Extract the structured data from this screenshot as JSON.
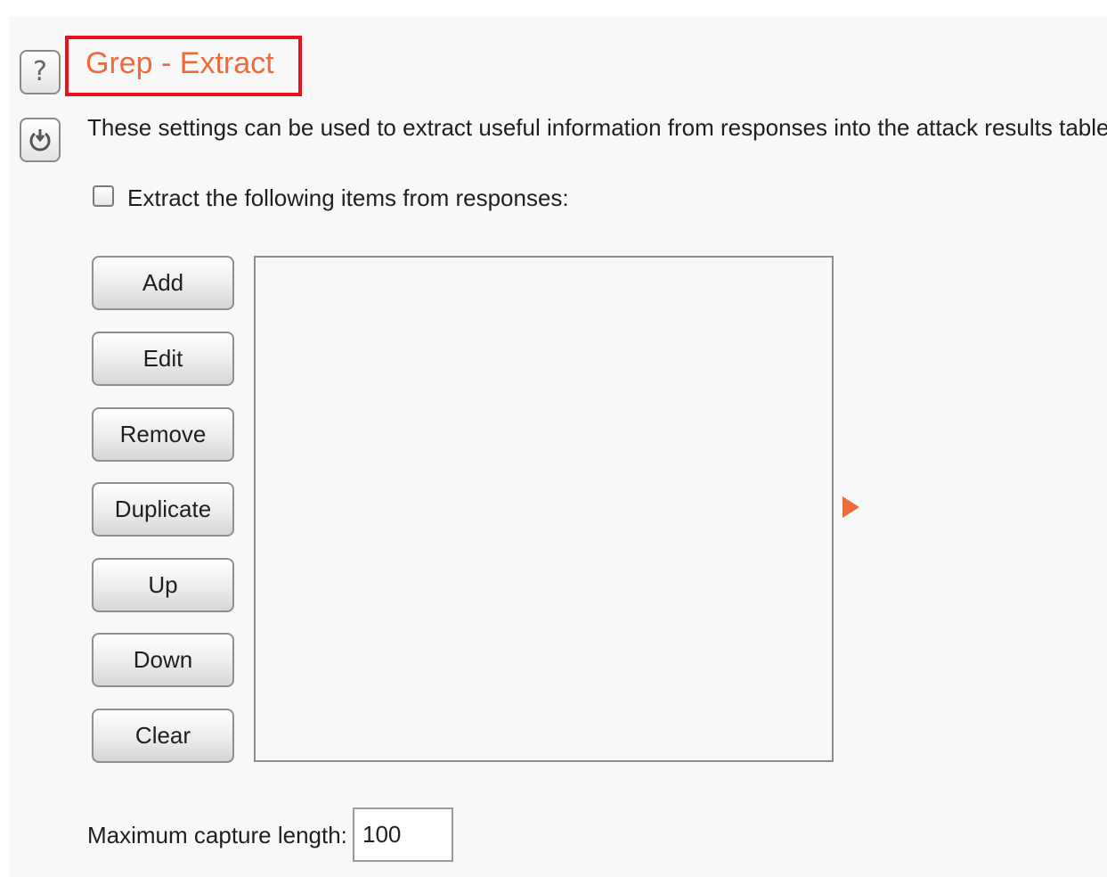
{
  "header": {
    "title": "Grep - Extract",
    "help_icon": "help-question-icon",
    "reset_icon": "restore-defaults-icon",
    "highlight_color": "#e8111c",
    "title_color": "#ef6a3a"
  },
  "description": "These settings can be used to extract useful information from responses into the attack results table.",
  "extract_option": {
    "label": "Extract the following items from responses:",
    "checked": false
  },
  "buttons": {
    "add": "Add",
    "edit": "Edit",
    "remove": "Remove",
    "duplicate": "Duplicate",
    "up": "Up",
    "down": "Down",
    "clear": "Clear"
  },
  "items_list": {
    "items": [],
    "expand_icon": "expand-arrow-icon"
  },
  "max_capture": {
    "label": "Maximum capture length:",
    "value": "100"
  }
}
